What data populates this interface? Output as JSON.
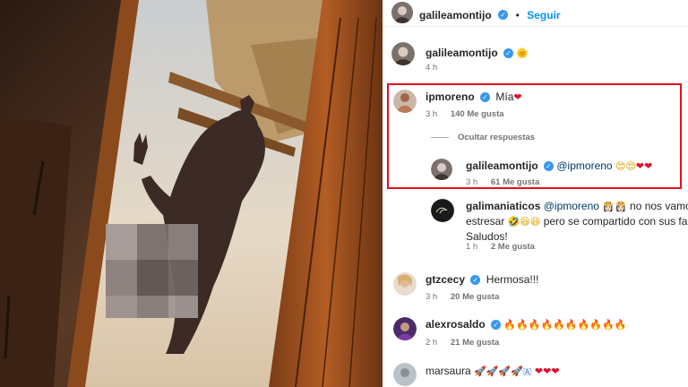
{
  "post": {
    "author": "galileamontijo",
    "follow_label": "Seguir",
    "dot": "•"
  },
  "comments": [
    {
      "username": "galileamontijo",
      "text": "",
      "emoji": "🌞",
      "time": "4 h"
    },
    {
      "username": "ipmoreno",
      "text": "Mía",
      "emoji": "❤",
      "time": "3 h",
      "likes": "140 Me gusta"
    },
    {
      "hide_label": "Ocultar respuestas"
    },
    {
      "username": "galileamontijo",
      "mention": "@ipmoreno",
      "emoji": "😍😍",
      "hearts": "❤❤",
      "time": "3 h",
      "likes": "61 Me gusta"
    },
    {
      "username": "galimaniaticos",
      "mention": "@ipmoreno",
      "emoji_a": "👸🏻👸🏻",
      "line1_rest": "no nos vamos a",
      "line2_a": "estresar",
      "emoji_b": "🤣😆😆",
      "line2_b": "pero se compartido con sus fans!",
      "line3": "Saludos!",
      "time": "1 h",
      "likes": "2 Me gusta"
    },
    {
      "username": "gtzcecy",
      "text": "Hermosa!!!",
      "time": "3 h",
      "likes": "20 Me gusta"
    },
    {
      "username": "alexrosaldo",
      "emoji": "🔥🔥🔥🔥🔥🔥🔥🔥🔥🔥",
      "time": "2 h",
      "likes": "21 Me gusta"
    },
    {
      "username": "marsaura",
      "emoji": "🚀🚀🚀🚀🇦",
      "hearts": "❤❤❤"
    }
  ],
  "colors": {
    "accent": "#0095f6",
    "verified": "#3897f0",
    "highlight_border": "#e3101f",
    "heart": "#e0102a"
  },
  "icons": {
    "verified": "verified-badge-icon",
    "heart": "heart-emoji-icon"
  }
}
